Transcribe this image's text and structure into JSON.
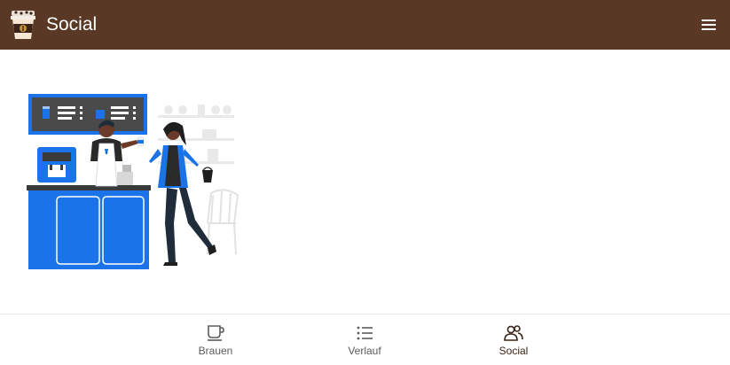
{
  "header": {
    "title": "Social",
    "logo_icon": "coffee-cup-logo-icon",
    "menu_icon": "hamburger-menu-icon"
  },
  "colors": {
    "header_bg": "#5a3826",
    "accent_blue": "#1a73e8",
    "active_nav": "#3b2417"
  },
  "main": {
    "illustration": "barista-coffee-shop-illustration"
  },
  "bottom_nav": {
    "items": [
      {
        "label": "Brauen",
        "icon": "coffee-cup-icon",
        "active": false
      },
      {
        "label": "Verlauf",
        "icon": "list-icon",
        "active": false
      },
      {
        "label": "Social",
        "icon": "people-icon",
        "active": true
      }
    ]
  }
}
